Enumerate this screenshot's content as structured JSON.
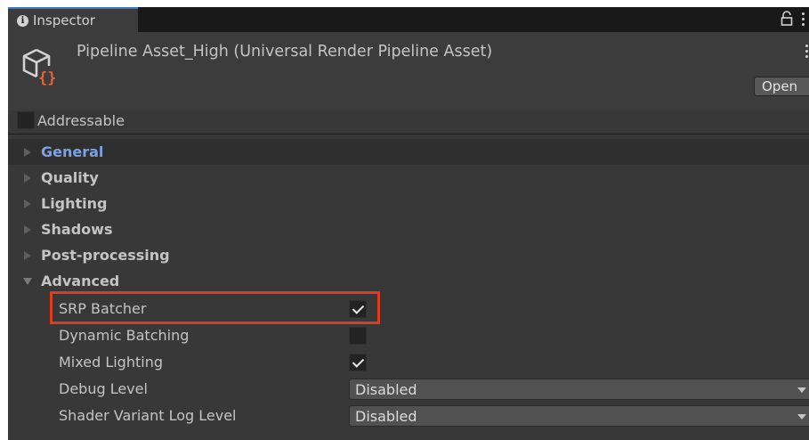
{
  "tab": {
    "label": "Inspector",
    "icon": "info-icon"
  },
  "tab_controls": {
    "lock_icon": "lock-icon",
    "menu_icon": "kebab-menu-icon"
  },
  "header": {
    "title": "Pipeline Asset_High (Universal Render Pipeline Asset)",
    "open_label": "Open",
    "addressable_label": "Addressable",
    "addressable_checked": false
  },
  "sections": [
    {
      "label": "General",
      "expanded": false,
      "selected": true
    },
    {
      "label": "Quality",
      "expanded": false,
      "selected": false
    },
    {
      "label": "Lighting",
      "expanded": false,
      "selected": false
    },
    {
      "label": "Shadows",
      "expanded": false,
      "selected": false
    },
    {
      "label": "Post-processing",
      "expanded": false,
      "selected": false
    },
    {
      "label": "Advanced",
      "expanded": true,
      "selected": false
    }
  ],
  "advanced": {
    "srp_batcher": {
      "label": "SRP Batcher",
      "checked": true
    },
    "dynamic_batching": {
      "label": "Dynamic Batching",
      "checked": false
    },
    "mixed_lighting": {
      "label": "Mixed Lighting",
      "checked": true
    },
    "debug_level": {
      "label": "Debug Level",
      "value": "Disabled"
    },
    "shader_variant_log_level": {
      "label": "Shader Variant Log Level",
      "value": "Disabled"
    }
  },
  "colors": {
    "highlight": "#e03c1f",
    "selected_section_text": "#7aa2e4",
    "asset_icon_outline": "#d2d2d2",
    "asset_icon_braces": "#e8642c"
  }
}
